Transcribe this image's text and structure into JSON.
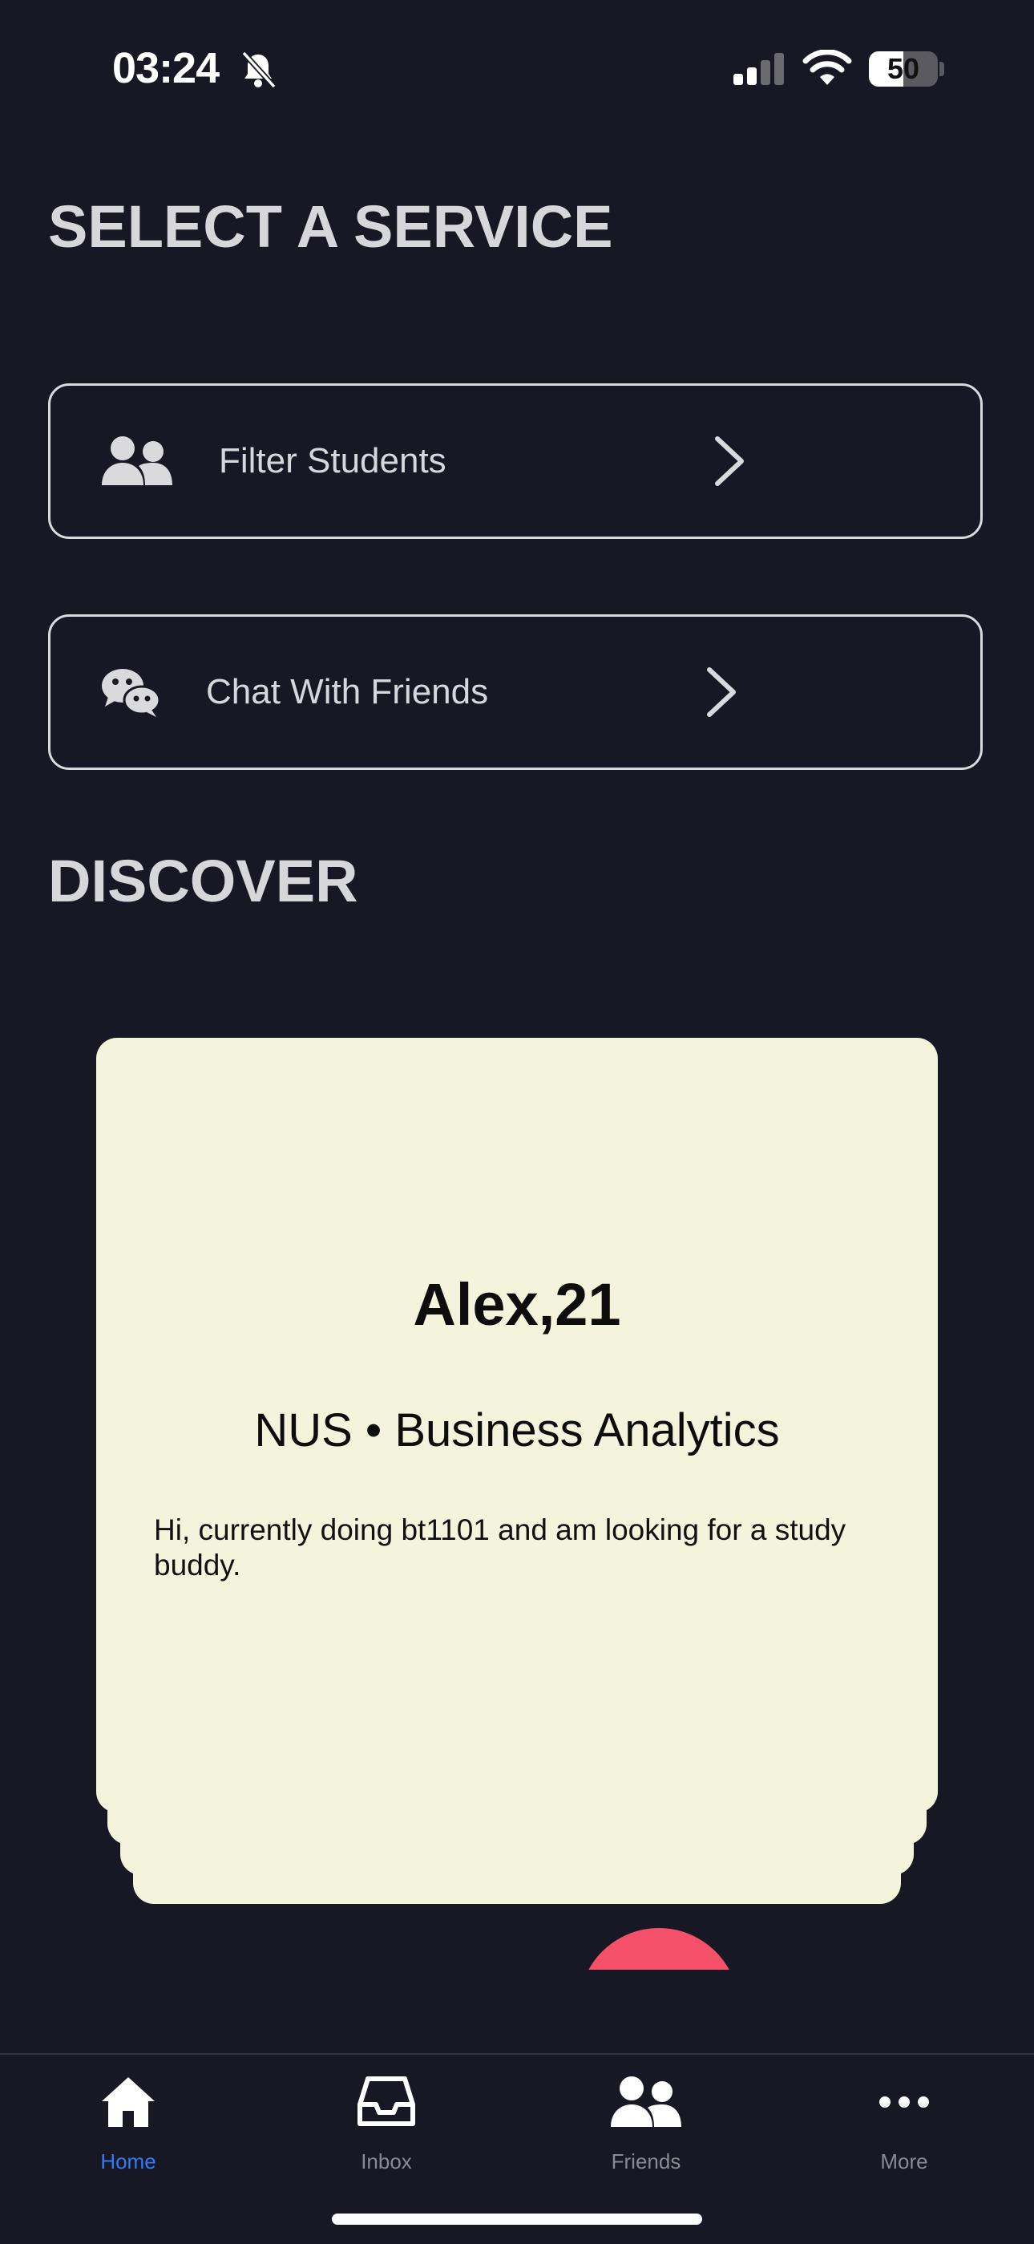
{
  "status_bar": {
    "time": "03:24",
    "battery": "50",
    "battery_level": 0.5
  },
  "sections": {
    "select_service": "SELECT A SERVICE",
    "discover": "DISCOVER"
  },
  "services": [
    {
      "label": "Filter Students",
      "icon": "people-icon"
    },
    {
      "label": "Chat With Friends",
      "icon": "wechat-icon"
    }
  ],
  "profile_card": {
    "name_age": "Alex,21",
    "school_major": "NUS • Business Analytics",
    "bio": "Hi, currently doing bt1101 and am looking for a study buddy."
  },
  "colors": {
    "background": "#181824",
    "card": "#f4f4dc",
    "accent": "#2f7cf6",
    "like": "#f5506a"
  },
  "tabs": [
    {
      "label": "Home",
      "icon": "home-icon",
      "active": true
    },
    {
      "label": "Inbox",
      "icon": "inbox-icon",
      "active": false
    },
    {
      "label": "Friends",
      "icon": "friends-icon",
      "active": false
    },
    {
      "label": "More",
      "icon": "more-icon",
      "active": false
    }
  ]
}
